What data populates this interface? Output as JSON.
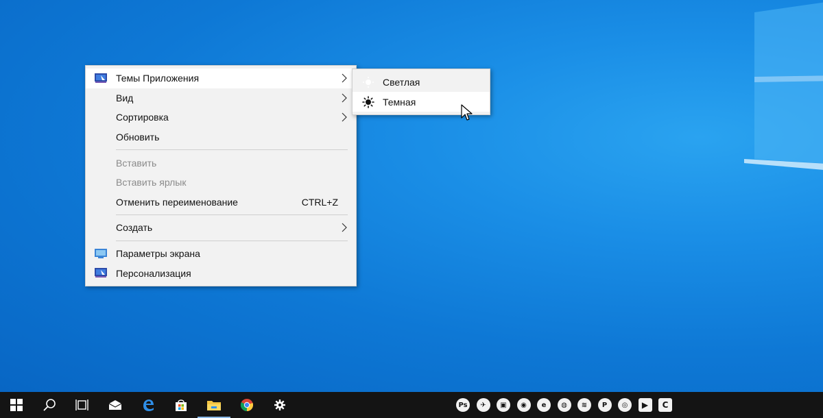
{
  "context_menu": {
    "items": [
      {
        "label": "Темы Приложения",
        "icon": "personalize-monitor-icon",
        "submenu": true
      },
      {
        "label": "Вид",
        "submenu": true
      },
      {
        "label": "Сортировка",
        "submenu": true
      },
      {
        "label": "Обновить"
      },
      {
        "label": "Вставить",
        "disabled": true
      },
      {
        "label": "Вставить ярлык",
        "disabled": true
      },
      {
        "label": "Отменить переименование",
        "shortcut": "CTRL+Z"
      },
      {
        "label": "Создать",
        "submenu": true
      },
      {
        "label": "Параметры экрана",
        "icon": "display-settings-icon"
      },
      {
        "label": "Персонализация",
        "icon": "personalize-monitor-icon"
      }
    ]
  },
  "submenu": {
    "items": [
      {
        "label": "Светлая",
        "icon": "sun-light-icon"
      },
      {
        "label": "Темная",
        "icon": "sun-dark-icon"
      }
    ]
  },
  "taskbar": {
    "apps": [
      "start-icon",
      "search-icon",
      "task-view-icon",
      "mail-icon",
      "edge-icon",
      "store-icon",
      "file-explorer-icon",
      "chrome-icon",
      "settings-icon"
    ],
    "tray": [
      {
        "name": "photoshop-icon",
        "glyph": "Ps"
      },
      {
        "name": "telegram-icon",
        "glyph": "✈"
      },
      {
        "name": "photos-icon",
        "glyph": "▣"
      },
      {
        "name": "chrome-tray-icon",
        "glyph": "◉"
      },
      {
        "name": "app-e-icon",
        "glyph": "e"
      },
      {
        "name": "app-disc-icon",
        "glyph": "◍"
      },
      {
        "name": "app-stack-icon",
        "glyph": "≋"
      },
      {
        "name": "app-p-icon",
        "glyph": "P"
      },
      {
        "name": "app-o-icon",
        "glyph": "◎"
      },
      {
        "name": "app-play-icon",
        "glyph": "▶"
      },
      {
        "name": "app-c-icon",
        "glyph": "C"
      }
    ]
  },
  "colors": {
    "desktop": "#0e78d5",
    "taskbar": "#141414",
    "menu_bg": "#f2f2f2",
    "menu_hover": "#ffffff",
    "disabled_text": "#8a8a8a"
  }
}
